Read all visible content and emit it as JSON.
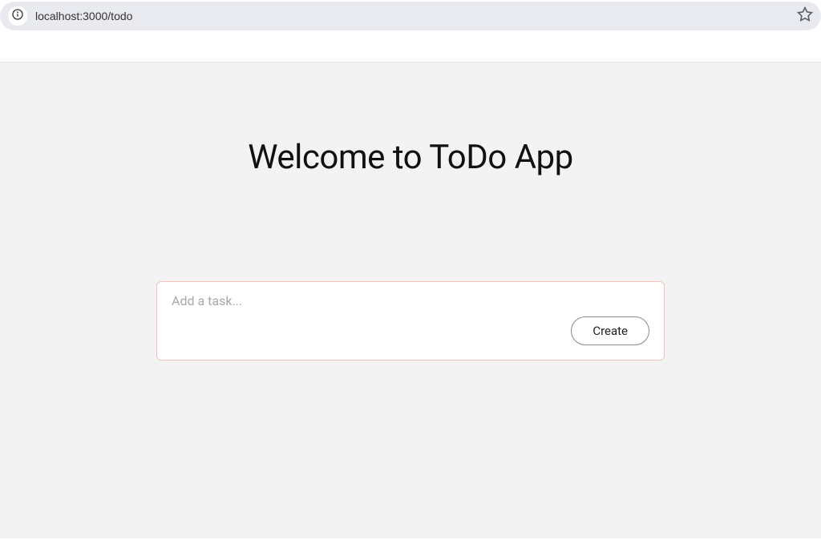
{
  "browser": {
    "url": "localhost:3000/todo"
  },
  "page": {
    "title": "Welcome to ToDo App"
  },
  "task_form": {
    "input_placeholder": "Add a task...",
    "input_value": "",
    "create_label": "Create"
  }
}
